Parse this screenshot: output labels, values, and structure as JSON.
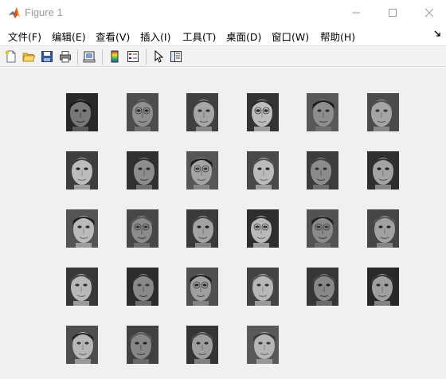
{
  "window": {
    "title": "Figure 1"
  },
  "menu": {
    "items": [
      "文件(F)",
      "编辑(E)",
      "查看(V)",
      "插入(I)",
      "工具(T)",
      "桌面(D)",
      "窗口(W)",
      "帮助(H)"
    ],
    "overflow_icon": "arrow-icon"
  },
  "toolbar": {
    "buttons": [
      "new-figure-icon",
      "open-file-icon",
      "save-icon",
      "print-icon",
      "link-plot-icon",
      "colorbar-icon",
      "legend-icon",
      "edit-plot-icon",
      "property-inspector-icon"
    ]
  },
  "figure": {
    "grid_rows": 5,
    "grid_cols": 6,
    "image_count": 28,
    "colormap": "gray"
  }
}
